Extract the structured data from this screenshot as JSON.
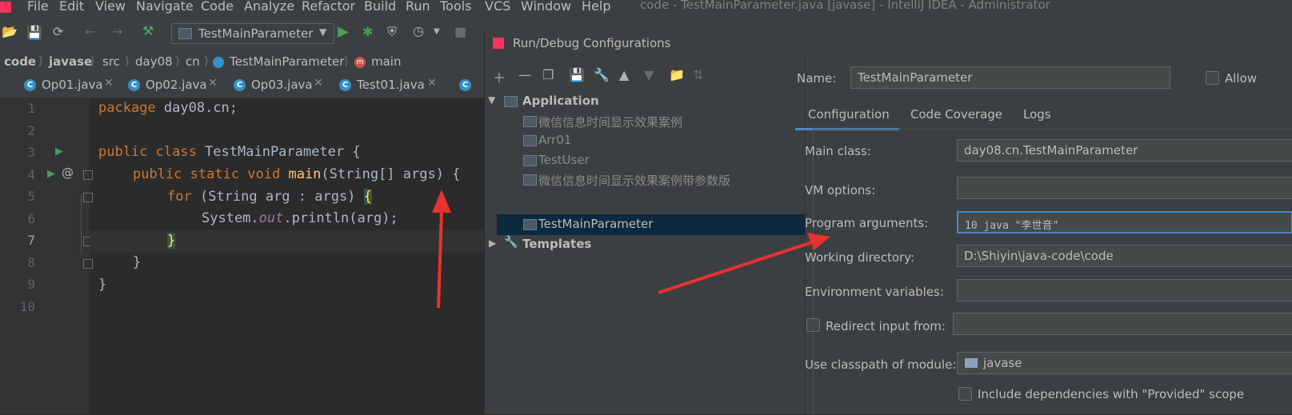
{
  "menubar": {
    "items": [
      "File",
      "Edit",
      "View",
      "Navigate",
      "Code",
      "Analyze",
      "Refactor",
      "Build",
      "Run",
      "Tools",
      "VCS",
      "Window",
      "Help"
    ],
    "app_title": "code - TestMainParameter.java [javase] - IntelliJ IDEA - Administrator"
  },
  "toolbar": {
    "run_config": "TestMainParameter"
  },
  "breadcrumb": {
    "items": [
      "code",
      "javase",
      "src",
      "day08",
      "cn",
      "TestMainParameter",
      "main"
    ]
  },
  "tabs": [
    {
      "label": "Op01.java"
    },
    {
      "label": "Op02.java"
    },
    {
      "label": "Op03.java"
    },
    {
      "label": "Test01.java"
    }
  ],
  "editor": {
    "line_numbers": [
      "1",
      "2",
      "3",
      "4",
      "5",
      "6",
      "7",
      "8",
      "9",
      "10"
    ],
    "lines": {
      "l1_kw": "package",
      "l1_rest": " day08.cn;",
      "l3_kw": "public class",
      "l3_rest": " TestMainParameter {",
      "l4_kw": "public static void",
      "l4_fn": " main",
      "l4_rest": "(String[] args) {",
      "l5_kw": "for",
      "l5_rest": " (String arg : args) ",
      "l5_brace": "{",
      "l6_a": "System.",
      "l6_field": "out",
      "l6_b": ".println(arg);",
      "l7_brace": "}",
      "l8": "}",
      "l9": "}"
    }
  },
  "dialog": {
    "title": "Run/Debug Configurations",
    "tree": {
      "application": "Application",
      "items": [
        "微信信息时间显示效果案例",
        "Arr01",
        "TestUser",
        "微信信息时间显示效果案例带参数版",
        "TestMainParameter"
      ],
      "templates": "Templates"
    },
    "name_label": "Name:",
    "name_value": "TestMainParameter",
    "allow_label": "Allow",
    "tabs": [
      "Configuration",
      "Code Coverage",
      "Logs"
    ],
    "main_class_label": "Main class:",
    "main_class_value": "day08.cn.TestMainParameter",
    "vm_options_label": "VM options:",
    "vm_options_value": "",
    "program_args_label": "Program arguments:",
    "program_args_value": "10 java \"李世音\"",
    "working_dir_label": "Working directory:",
    "working_dir_value": "D:\\Shiyin\\java-code\\code",
    "env_vars_label": "Environment variables:",
    "redirect_label": "Redirect input from:",
    "classpath_label": "Use classpath of module:",
    "classpath_value": "javase",
    "include_deps_label": "Include dependencies with \"Provided\" scope"
  },
  "colors": {
    "annotation_arrow": "#e8322e",
    "selection": "#0d293e",
    "accent": "#4a88c7"
  }
}
